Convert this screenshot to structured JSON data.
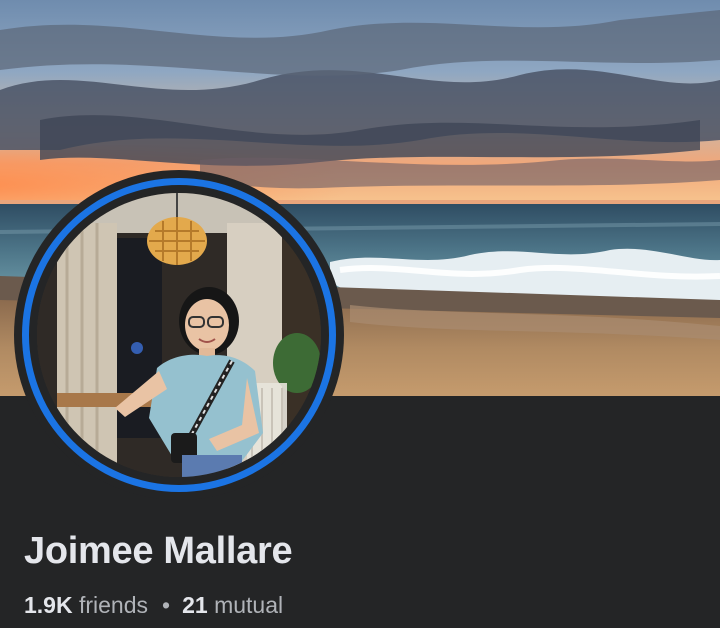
{
  "profile": {
    "name": "Joimee Mallare",
    "friends_count": "1.9K",
    "friends_label": "friends",
    "separator": "•",
    "mutual_count": "21",
    "mutual_label": "mutual"
  },
  "colors": {
    "background": "#242526",
    "avatar_ring": "#1b74e4",
    "name_text": "#e4e6eb",
    "secondary_text": "#b0b3b8"
  }
}
